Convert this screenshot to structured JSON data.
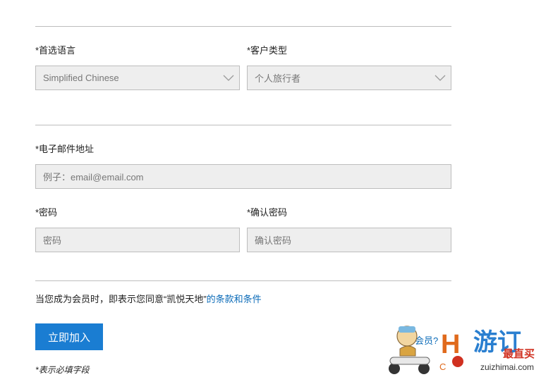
{
  "form": {
    "language": {
      "label": "*首选语言",
      "value": "Simplified Chinese"
    },
    "customer_type": {
      "label": "*客户类型",
      "value": "个人旅行者"
    },
    "email": {
      "label": "*电子邮件地址",
      "placeholder": "例子：email@email.com"
    },
    "password": {
      "label": "*密码",
      "placeholder": "密码"
    },
    "confirm_password": {
      "label": "*确认密码",
      "placeholder": "确认密码"
    },
    "terms_prefix": "当您成为会员时，即表示您同意“凯悦天地”",
    "terms_link": "的条款和条件",
    "join_button": "立即加入",
    "required_note": "*表示必填字段"
  },
  "side": {
    "member_link": "会员?"
  },
  "watermark": {
    "logo_text": "游订",
    "tagline": "最直买",
    "url": "zuizhimai.com"
  },
  "colors": {
    "accent": "#1a7dd2",
    "link": "#0b6bb8",
    "field_bg": "#eeeeee"
  },
  "icons": {
    "select_arrow": "chevron-down-icon"
  }
}
